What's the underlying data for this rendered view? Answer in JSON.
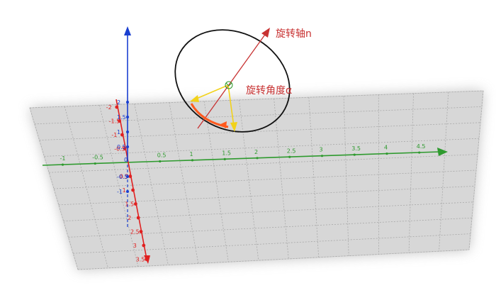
{
  "annotations": {
    "rotation_axis": "旋转轴n",
    "rotation_angle": "旋转角度α"
  },
  "colors": {
    "x_axis": "#2e9a2e",
    "y_axis": "#e02020",
    "z_axis": "#1a3fd0",
    "annotation_text": "#c83232",
    "rotation_axis_arrow": "#c83232",
    "vectors": "#f2d21a",
    "angle_arc": "#ff5a1e",
    "ellipse": "#111111",
    "right_angle_marker": "#2e9a2e",
    "grid_plane": "#d7d7d7"
  },
  "axes": {
    "x_ticks": [
      "-1",
      "-0.5",
      "0",
      "0.5",
      "1",
      "1.5",
      "2",
      "2.5",
      "3",
      "3.5",
      "4",
      "4.5"
    ],
    "y_ticks": [
      "-2",
      "-1.5",
      "-1",
      "-0.5",
      "0",
      "0.5",
      "1",
      "1.5",
      "2",
      "2.5",
      "3",
      "3.5"
    ],
    "z_ticks": [
      "2",
      "1.5",
      "1",
      "0.5",
      "0",
      "-0.5",
      "-1"
    ]
  }
}
